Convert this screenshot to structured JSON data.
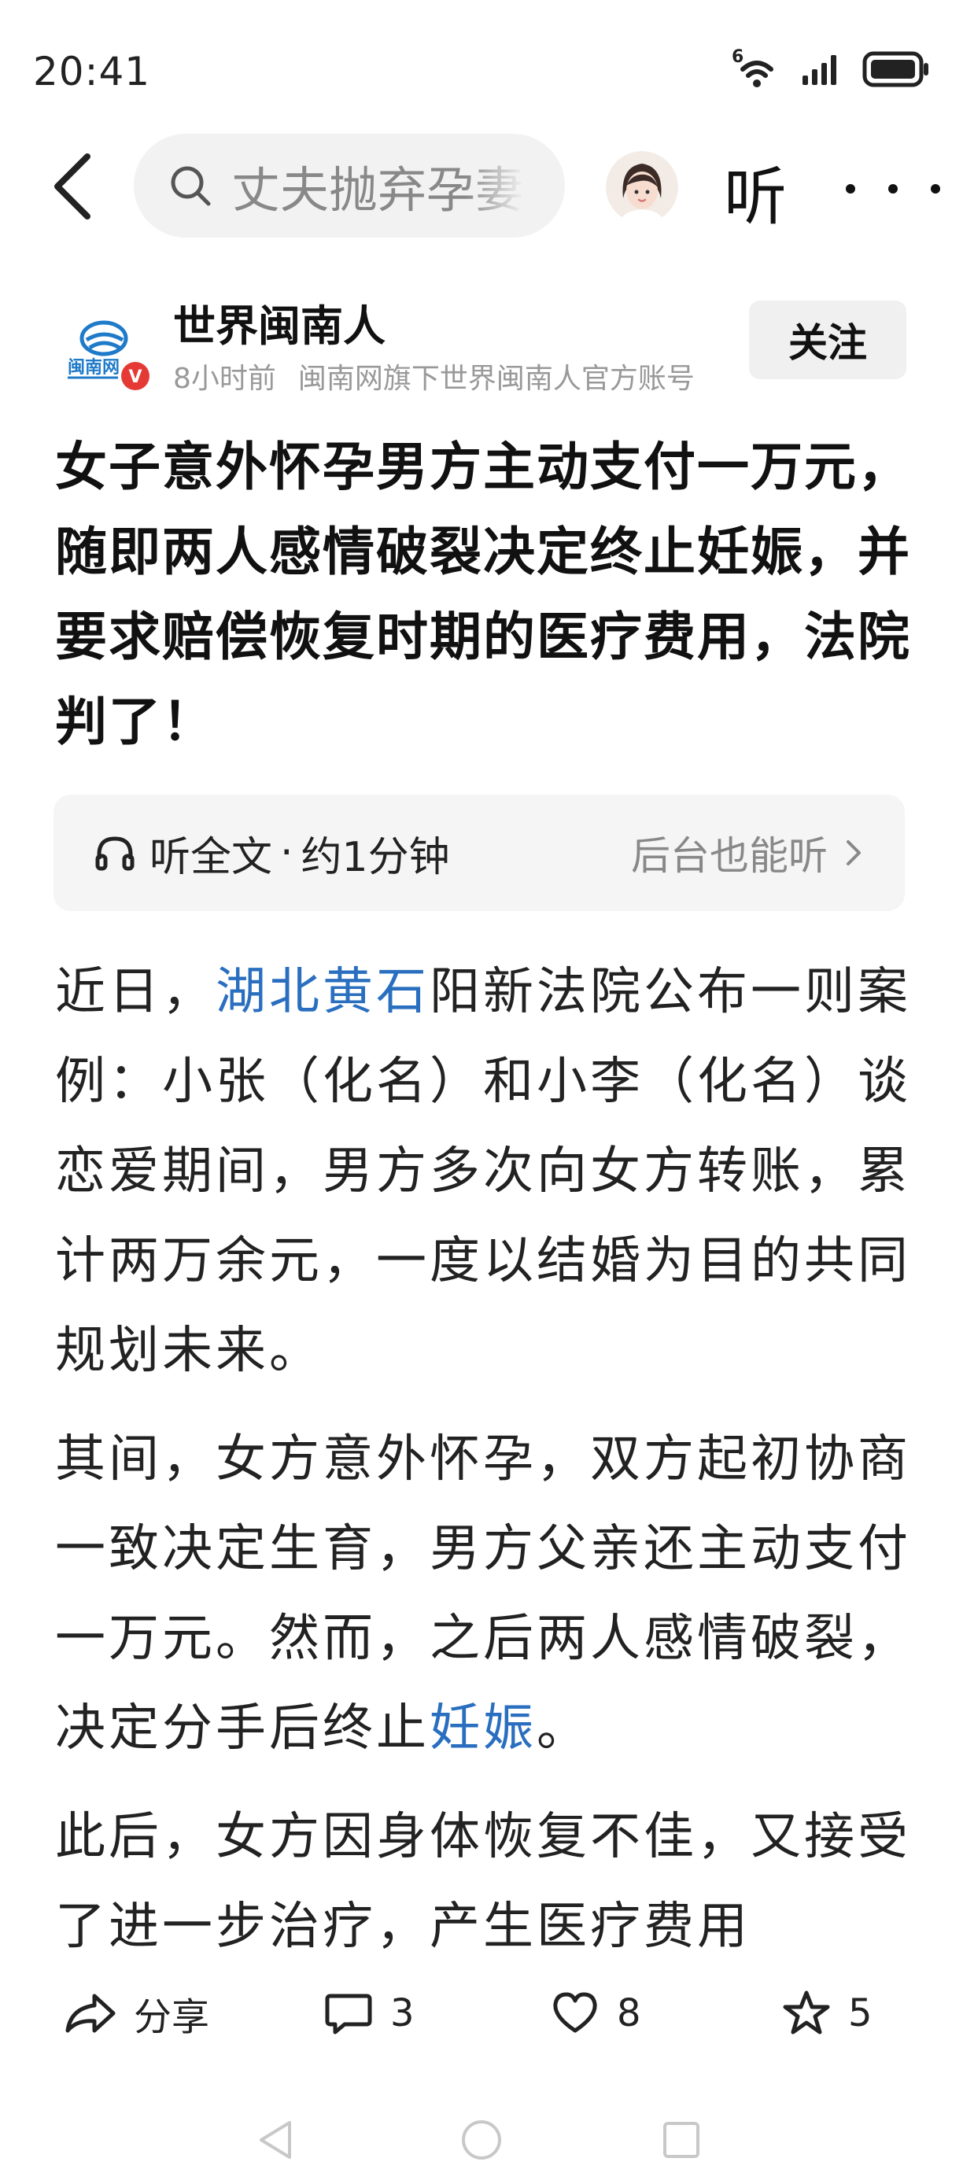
{
  "status_bar": {
    "time": "20:41",
    "network": "6",
    "icons": [
      "wifi-icon",
      "signal-icon",
      "battery-icon"
    ]
  },
  "header": {
    "search_text": "丈夫抛弃孕妻",
    "listen_label": "听"
  },
  "author": {
    "name": "世界闽南人",
    "time_ago": "8小时前",
    "description": "闽南网旗下世界闽南人官方账号",
    "follow_label": "关注",
    "logo_text": "闽南网",
    "verified_badge": "V"
  },
  "article": {
    "title": "女子意外怀孕男方主动支付一万元，随即两人感情破裂决定终止妊娠，并要求赔偿恢复时期的医疗费用，法院判了！",
    "listen_bar": {
      "left_text": "听全文",
      "separator": "·",
      "duration": "约1分钟",
      "right_text": "后台也能听"
    },
    "p1_before": "近日，",
    "p1_link": "湖北黄石",
    "p1_after": "阳新法院公布一则案例：小张（化名）和小李（化名）谈恋爱期间，男方多次向女方转账，累计两万余元，一度以结婚为目的共同规划未来。",
    "p2_before": "其间，女方意外怀孕，双方起初协商一致决定生育，男方父亲还主动支付一万元。然而，之后两人感情破裂，决定分手后终止",
    "p2_link": "妊娠",
    "p2_after": "。",
    "p3": "此后，女方因身体恢复不佳，又接受了进一步治疗，产生医疗费用"
  },
  "actions": {
    "share_label": "分享",
    "comment_count": "3",
    "like_count": "8",
    "favorite_count": "5"
  },
  "colors": {
    "link": "#2a6fbf",
    "logo_blue": "#1f7ac9",
    "badge_red": "#e53935"
  }
}
